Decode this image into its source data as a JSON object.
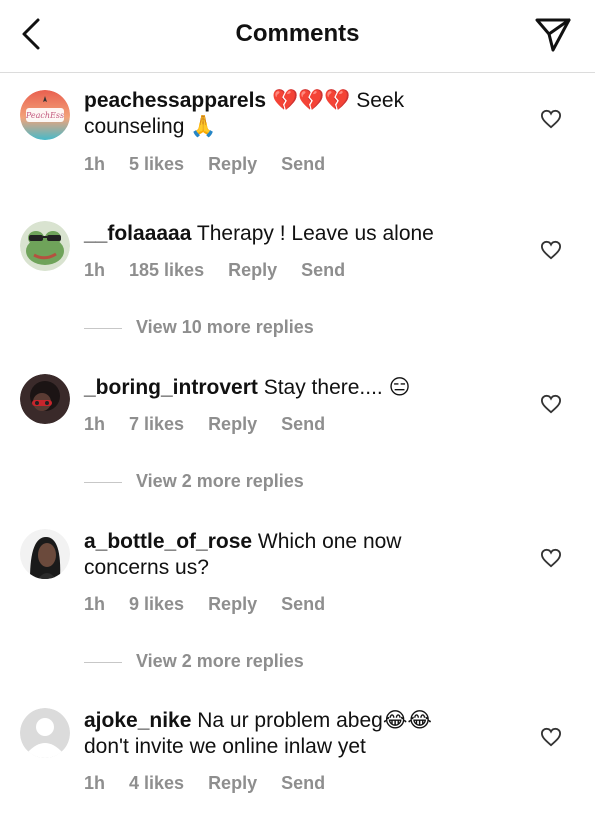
{
  "header": {
    "title": "Comments"
  },
  "logo_text": "PeachEss",
  "comments": [
    {
      "username": "peachessapparels",
      "text_a": " 💔💔💔 Seek",
      "text_b": "counseling 🙏",
      "time": "1h",
      "likes": "5 likes",
      "reply": "Reply",
      "send": "Send"
    },
    {
      "username": "__folaaaaa",
      "text_a": " Therapy ! Leave us alone",
      "time": "1h",
      "likes": "185 likes",
      "reply": "Reply",
      "send": "Send",
      "more": "View 10 more replies"
    },
    {
      "username": "_boring_introvert",
      "text_a": " Stay there.... 😑",
      "time": "1h",
      "likes": "7 likes",
      "reply": "Reply",
      "send": "Send",
      "more": "View 2 more replies"
    },
    {
      "username": "a_bottle_of_rose",
      "text_a": " Which one now",
      "text_b": "concerns us?",
      "time": "1h",
      "likes": "9 likes",
      "reply": "Reply",
      "send": "Send",
      "more": "View 2 more replies"
    },
    {
      "username": "ajoke_nike",
      "text_a": " Na ur problem abeg😂😂",
      "text_b": "don't invite we online inlaw yet",
      "time": "1h",
      "likes": "4 likes",
      "reply": "Reply",
      "send": "Send"
    }
  ],
  "icons": {
    "back": "chevron-left-icon",
    "send": "paper-plane-icon",
    "like": "heart-outline-icon"
  }
}
